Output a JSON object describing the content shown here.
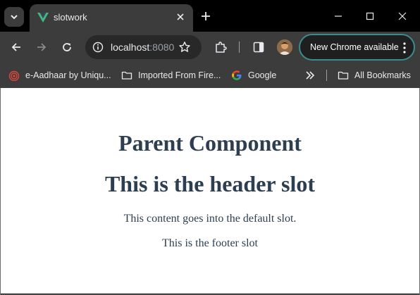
{
  "browser": {
    "tab": {
      "title": "slotwork",
      "favicon": "vue-logo-icon"
    },
    "window_controls": [
      "minimize-icon",
      "maximize-icon",
      "close-icon"
    ],
    "toolbar": {
      "url_host": "localhost",
      "url_port": ":8080",
      "update_label": "New Chrome available"
    },
    "bookmarks": [
      {
        "label": "e-Aadhaar by Uniqu...",
        "icon": "aadhaar-icon"
      },
      {
        "label": "Imported From Fire...",
        "icon": "folder-icon"
      },
      {
        "label": "Google",
        "icon": "google-icon"
      },
      {
        "label": "All Bookmarks",
        "icon": "folder-icon"
      }
    ],
    "colors": {
      "frame": "#000000",
      "toolbar": "#3c3c3c",
      "accent": "#3e8b8f",
      "vue_green": "#41b883"
    }
  },
  "page": {
    "title": "Parent Component",
    "header_slot": "This is the header slot",
    "default_slot": "This content goes into the default slot.",
    "footer_slot": "This is the footer slot",
    "text_color": "#2c3e50"
  }
}
